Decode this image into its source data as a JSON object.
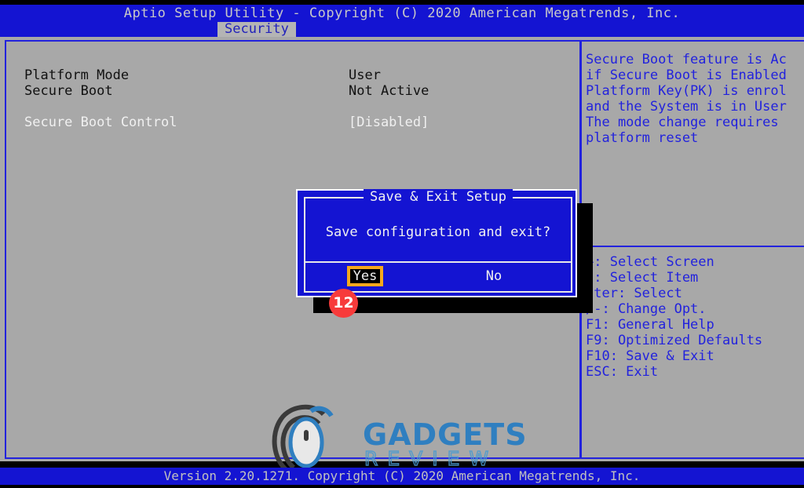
{
  "titlebar": {
    "text": "Aptio Setup Utility - Copyright (C) 2020 American Megatrends, Inc."
  },
  "tabs": [
    {
      "label": "Security",
      "active": true
    }
  ],
  "main_panel": {
    "rows": [
      {
        "label": "Platform Mode",
        "value": "User",
        "label_style": "dark",
        "value_style": "dark"
      },
      {
        "label": "Secure Boot",
        "value": "Not Active",
        "label_style": "dark",
        "value_style": "dark"
      },
      {
        "label": "Secure Boot Control",
        "value": "[Disabled]",
        "label_style": "light",
        "value_style": "light"
      }
    ]
  },
  "help_panel": {
    "description_lines": [
      "Secure Boot feature is Ac",
      "if Secure Boot is Enabled",
      "Platform Key(PK) is enrol",
      "and the System is in User",
      "The mode change requires",
      "platform reset"
    ],
    "key_legend": [
      "←: Select Screen",
      "↓: Select Item",
      "nter: Select",
      "/-: Change Opt.",
      "F1: General Help",
      "F9: Optimized Defaults",
      "F10: Save & Exit",
      "ESC: Exit"
    ]
  },
  "dialog": {
    "title": "Save & Exit Setup",
    "message": "Save configuration and exit?",
    "buttons": [
      {
        "label": "Yes",
        "selected": true
      },
      {
        "label": "No",
        "selected": false
      }
    ]
  },
  "step_badge": {
    "number": "12"
  },
  "watermark": {
    "title": "GADGETS",
    "subtitle": "REVIEW"
  },
  "statusbar": {
    "text": "Version 2.20.1271. Copyright (C) 2020 American Megatrends, Inc."
  },
  "colors": {
    "bios_blue": "#1414d2",
    "panel_gray": "#a8a8a8",
    "border_blue": "#2222dd",
    "highlight_orange": "#f5a81c",
    "badge_red": "#f73b3b",
    "watermark_blue": "#2f7fc0"
  }
}
